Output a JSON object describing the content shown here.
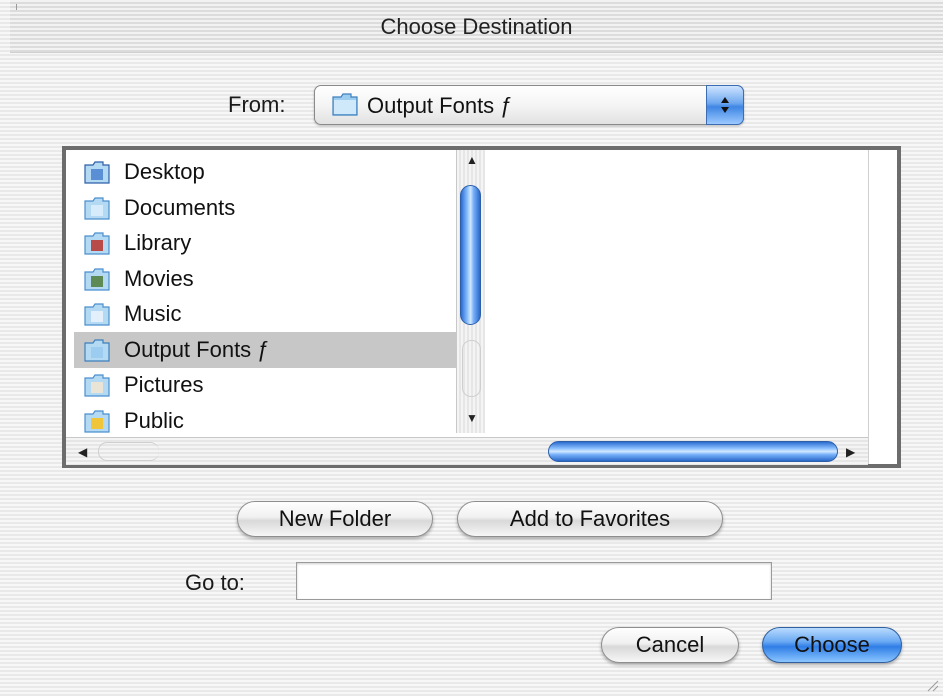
{
  "dialog": {
    "title": "Choose Destination"
  },
  "from": {
    "label": "From:",
    "selected": "Output Fonts ƒ",
    "icon": "folder-icon"
  },
  "browser": {
    "items": [
      {
        "label": "Desktop",
        "icon": "desktop-folder-icon"
      },
      {
        "label": "Documents",
        "icon": "documents-folder-icon"
      },
      {
        "label": "Library",
        "icon": "library-folder-icon"
      },
      {
        "label": "Movies",
        "icon": "movies-folder-icon"
      },
      {
        "label": "Music",
        "icon": "music-folder-icon"
      },
      {
        "label": "Output Fonts ƒ",
        "icon": "folder-icon",
        "selected": true
      },
      {
        "label": "Pictures",
        "icon": "pictures-folder-icon"
      },
      {
        "label": "Public",
        "icon": "public-folder-icon"
      }
    ]
  },
  "buttons": {
    "new_folder": "New Folder",
    "add_to_favorites": "Add to Favorites",
    "cancel": "Cancel",
    "choose": "Choose"
  },
  "goto": {
    "label": "Go to:",
    "value": ""
  },
  "colors": {
    "accent": "#3f86e4",
    "selection": "#c7c7c7"
  }
}
